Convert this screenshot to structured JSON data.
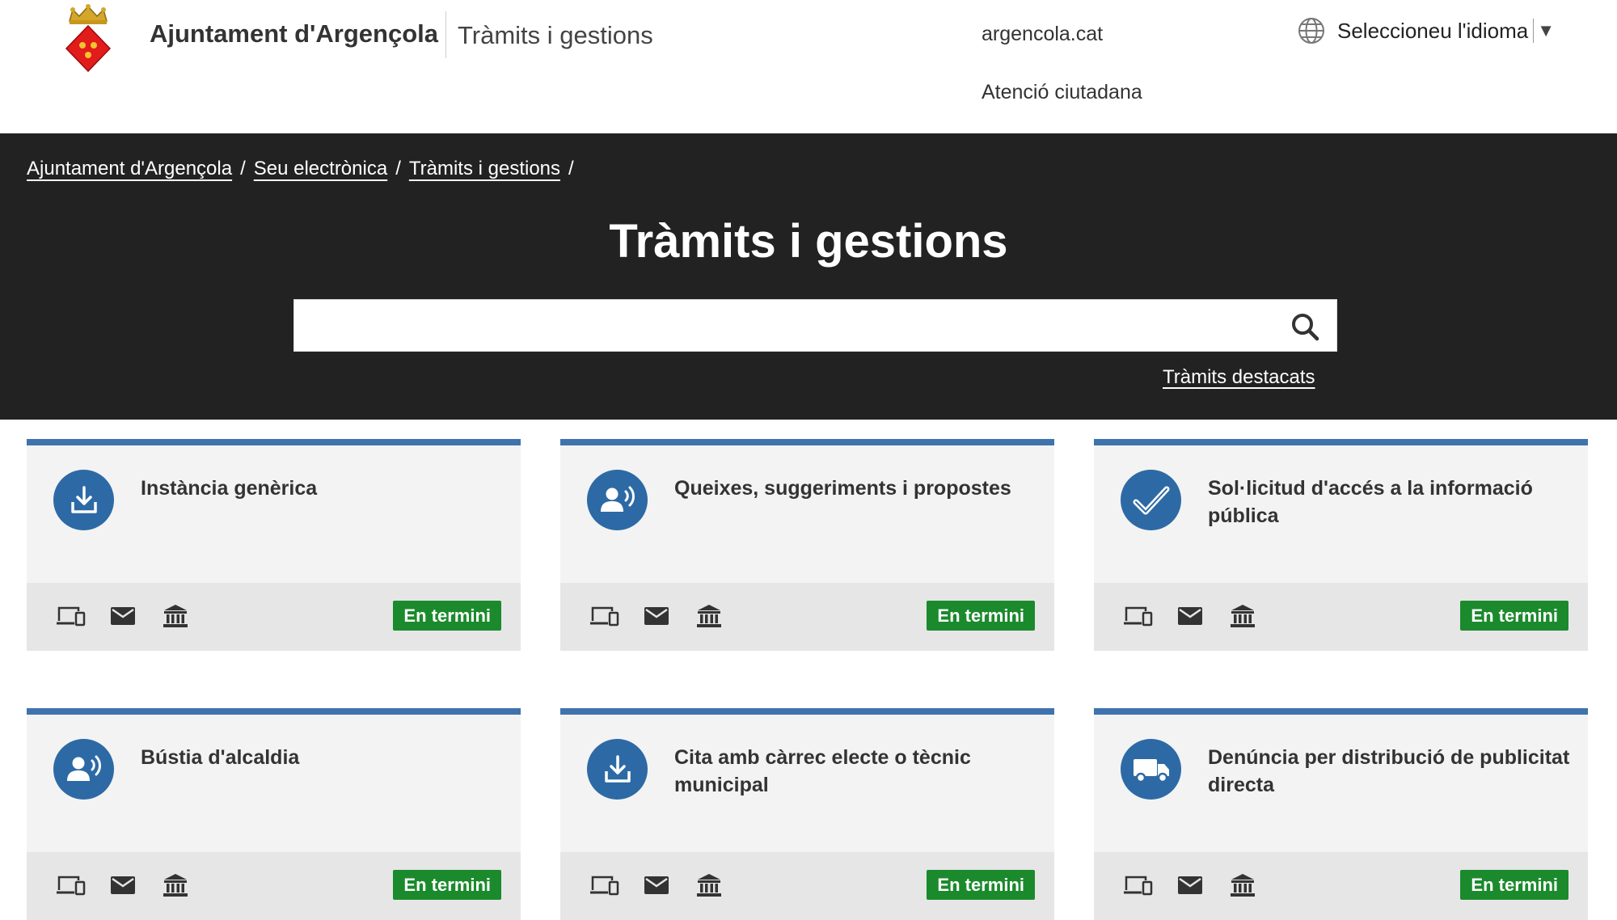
{
  "header": {
    "org_name": "Ajuntament d'Argençola",
    "section": "Tràmits i gestions",
    "links": [
      "argencola.cat",
      "Atenció ciutadana"
    ],
    "language_label": "Seleccioneu l'idioma"
  },
  "banner": {
    "breadcrumb": [
      "Ajuntament d'Argençola",
      "Seu electrònica",
      "Tràmits i gestions"
    ],
    "breadcrumb_sep": "/",
    "title": "Tràmits i gestions",
    "search_placeholder": "",
    "featured_link": "Tràmits destacats"
  },
  "cards": [
    {
      "title": "Instància genèrica",
      "icon": "download-icon",
      "status": "En termini"
    },
    {
      "title": "Queixes, suggeriments i propostes",
      "icon": "speaking-person-icon",
      "status": "En termini"
    },
    {
      "title": "Sol·licitud d'accés a la informació pública",
      "icon": "checkmark-icon",
      "status": "En termini"
    },
    {
      "title": "Bústia d'alcaldia",
      "icon": "speaking-person-icon",
      "status": "En termini"
    },
    {
      "title": "Cita amb càrrec electe o tècnic municipal",
      "icon": "download-icon",
      "status": "En termini"
    },
    {
      "title": "Denúncia per distribució de publicitat directa",
      "icon": "truck-icon",
      "status": "En termini"
    }
  ],
  "channel_icons": [
    "online-device-icon",
    "mail-icon",
    "office-building-icon"
  ],
  "colors": {
    "accent_blue": "#3f73ad",
    "icon_circle": "#2d6aa5",
    "status_green": "#1b8a2c",
    "banner_bg": "#222222"
  }
}
